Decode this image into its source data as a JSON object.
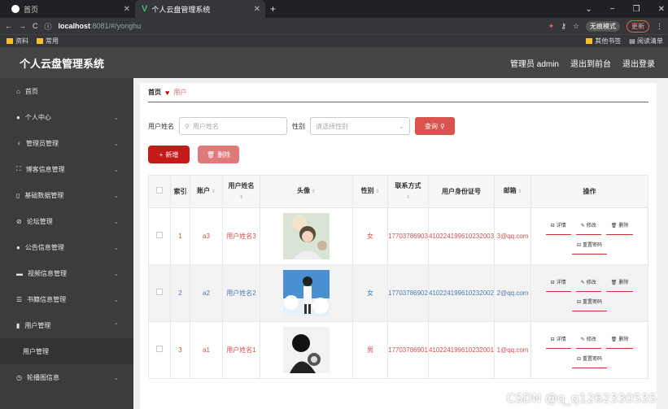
{
  "browser": {
    "tab1_title": "首页",
    "tab2_title": "个人云盘管理系统",
    "url_host": "localhost",
    "url_path": ":8081/#/yonghu",
    "incognito_label": "无痕模式",
    "update_label": "更新",
    "bookmarks": [
      "资料",
      "常用"
    ],
    "bookmarks_right": [
      "其他书签",
      "阅读清单"
    ]
  },
  "header": {
    "title": "个人云盘管理系统",
    "admin": "管理员 admin",
    "to_front": "退出到前台",
    "logout": "退出登录"
  },
  "sidebar": {
    "items": [
      {
        "label": "首页",
        "icon": "home-icon"
      },
      {
        "label": "个人中心",
        "icon": "user-icon"
      },
      {
        "label": "管理员管理",
        "icon": "mic-icon"
      },
      {
        "label": "博客信息管理",
        "icon": "frame-icon"
      },
      {
        "label": "基础数据管理",
        "icon": "phone-icon"
      },
      {
        "label": "论坛管理",
        "icon": "compass-icon"
      },
      {
        "label": "公告信息管理",
        "icon": "person-icon"
      },
      {
        "label": "视频信息管理",
        "icon": "monitor-icon"
      },
      {
        "label": "书籍信息管理",
        "icon": "list-icon"
      },
      {
        "label": "用户管理",
        "icon": "chart-icon"
      },
      {
        "label": "用户管理",
        "icon": ""
      },
      {
        "label": "轮播图信息",
        "icon": "clock-icon"
      }
    ]
  },
  "breadcrumb": {
    "home": "首页",
    "current": "用户"
  },
  "filters": {
    "name_label": "用户姓名",
    "name_placeholder": "用户姓名",
    "gender_label": "性别",
    "gender_placeholder": "请选择性别",
    "search_label": "查询"
  },
  "actions": {
    "add": "新增",
    "delete": "删除"
  },
  "table": {
    "headers": [
      "索引",
      "账户",
      "用户姓名",
      "头像",
      "性别",
      "联系方式",
      "用户身份证号",
      "邮箱",
      "操作"
    ],
    "rows": [
      {
        "index": "1",
        "account": "a3",
        "name": "用户姓名3",
        "gender": "女",
        "phone": "17703786903",
        "idcard": "410224199610232003",
        "email": "3@qq.com"
      },
      {
        "index": "2",
        "account": "a2",
        "name": "用户姓名2",
        "gender": "女",
        "phone": "17703786902",
        "idcard": "410224199610232002",
        "email": "2@qq.com"
      },
      {
        "index": "3",
        "account": "a1",
        "name": "用户姓名1",
        "gender": "男",
        "phone": "17703786901",
        "idcard": "410224199610232001",
        "email": "1@qq.com"
      }
    ],
    "ops": {
      "detail": "详情",
      "edit": "修改",
      "delete": "删除",
      "reset": "重置密码"
    }
  },
  "watermark": "CSDN @q_q1262330535"
}
